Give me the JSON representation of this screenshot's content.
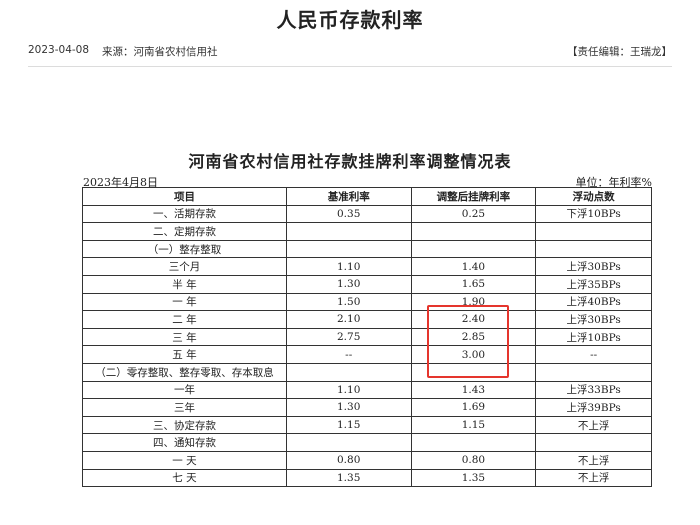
{
  "header": {
    "title": "人民币存款利率",
    "date": "2023-04-08",
    "source": "来源：河南省农村信用社",
    "editor": "【责任编辑：王瑞龙】"
  },
  "document": {
    "title": "河南省农村信用社存款挂牌利率调整情况表",
    "date": "2023年4月8日",
    "unit": "单位：年利率%"
  },
  "table": {
    "headers": [
      "项目",
      "基准利率",
      "调整后挂牌利率",
      "浮动点数"
    ],
    "rows": [
      {
        "item": "一、活期存款",
        "base": "0.35",
        "adjusted": "0.25",
        "float": "下浮10BPs"
      },
      {
        "item": "二、定期存款",
        "base": "",
        "adjusted": "",
        "float": ""
      },
      {
        "item": "（一）整存整取",
        "base": "",
        "adjusted": "",
        "float": ""
      },
      {
        "item": "三个月",
        "base": "1.10",
        "adjusted": "1.40",
        "float": "上浮30BPs"
      },
      {
        "item": "半 年",
        "base": "1.30",
        "adjusted": "1.65",
        "float": "上浮35BPs"
      },
      {
        "item": "一 年",
        "base": "1.50",
        "adjusted": "1.90",
        "float": "上浮40BPs"
      },
      {
        "item": "二 年",
        "base": "2.10",
        "adjusted": "2.40",
        "float": "上浮30BPs"
      },
      {
        "item": "三 年",
        "base": "2.75",
        "adjusted": "2.85",
        "float": "上浮10BPs"
      },
      {
        "item": "五 年",
        "base": "--",
        "adjusted": "3.00",
        "float": "--"
      },
      {
        "item": "（二）零存整取、整存零取、存本取息",
        "base": "",
        "adjusted": "",
        "float": ""
      },
      {
        "item": "一年",
        "base": "1.10",
        "adjusted": "1.43",
        "float": "上浮33BPs"
      },
      {
        "item": "三年",
        "base": "1.30",
        "adjusted": "1.69",
        "float": "上浮39BPs"
      },
      {
        "item": "三、协定存款",
        "base": "1.15",
        "adjusted": "1.15",
        "float": "不上浮"
      },
      {
        "item": "四、通知存款",
        "base": "",
        "adjusted": "",
        "float": ""
      },
      {
        "item": "一 天",
        "base": "0.80",
        "adjusted": "0.80",
        "float": "不上浮"
      },
      {
        "item": "七 天",
        "base": "1.35",
        "adjusted": "1.35",
        "float": "不上浮"
      }
    ]
  },
  "colors": {
    "highlight": "#e5352d",
    "border": "#333333"
  }
}
